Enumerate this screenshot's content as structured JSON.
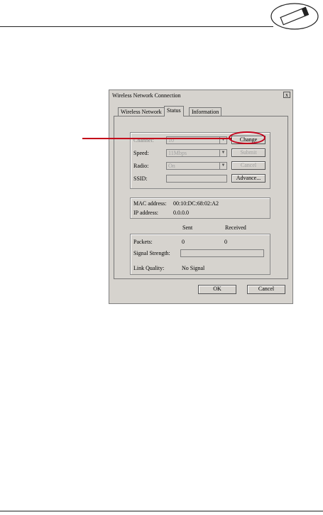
{
  "dialog": {
    "title": "Wireless Network Connection",
    "close_label": "x",
    "tabs": [
      {
        "label": "Wireless Network"
      },
      {
        "label": "Status"
      },
      {
        "label": "Information"
      }
    ],
    "settings": {
      "channel": {
        "label": "Channel:",
        "value": "10"
      },
      "speed": {
        "label": "Speed:",
        "value": "11Mbps"
      },
      "radio": {
        "label": "Radio:",
        "value": "On"
      },
      "ssid": {
        "label": "SSID:",
        "value": ""
      },
      "change_label": "Change",
      "submit_label": "Submit",
      "cancel_label": "Cancel",
      "advance_label": "Advance..."
    },
    "address": {
      "mac_label": "MAC address:",
      "mac_value": "00:10:DC:68:02:A2",
      "ip_label": "IP address:",
      "ip_value": "0.0.0.0"
    },
    "stats": {
      "sent_header": "Sent",
      "received_header": "Received",
      "packets_label": "Packets:",
      "packets_sent": "0",
      "packets_received": "0",
      "signal_label": "Signal Strength:",
      "link_label": "Link Quality:",
      "link_value": "No Signal"
    },
    "ok_label": "OK",
    "footer_cancel_label": "Cancel"
  },
  "callout": {
    "color": "#c4001a"
  }
}
